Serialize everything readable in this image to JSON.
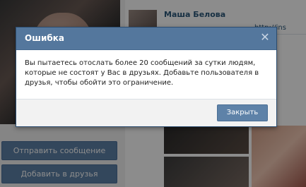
{
  "background": {
    "friend_name": "Маша Белова",
    "friend_link": "http://ins",
    "buttons": {
      "send_message": "Отправить сообщение",
      "add_friend": "Добавить в друзья"
    }
  },
  "dialog": {
    "title": "Ошибка",
    "message": "Вы пытаетесь отослать более 20 сообщений за сутки людям, которые не состоят у Вас в друзьях. Добавьте пользователя в друзья, чтобы обойти это ограничение.",
    "button": "Закрыть",
    "close_icon": "close-icon"
  },
  "colors": {
    "header": "#54779d",
    "button": "#5e82a8",
    "overlay": "rgba(0,0,0,0.45)"
  }
}
